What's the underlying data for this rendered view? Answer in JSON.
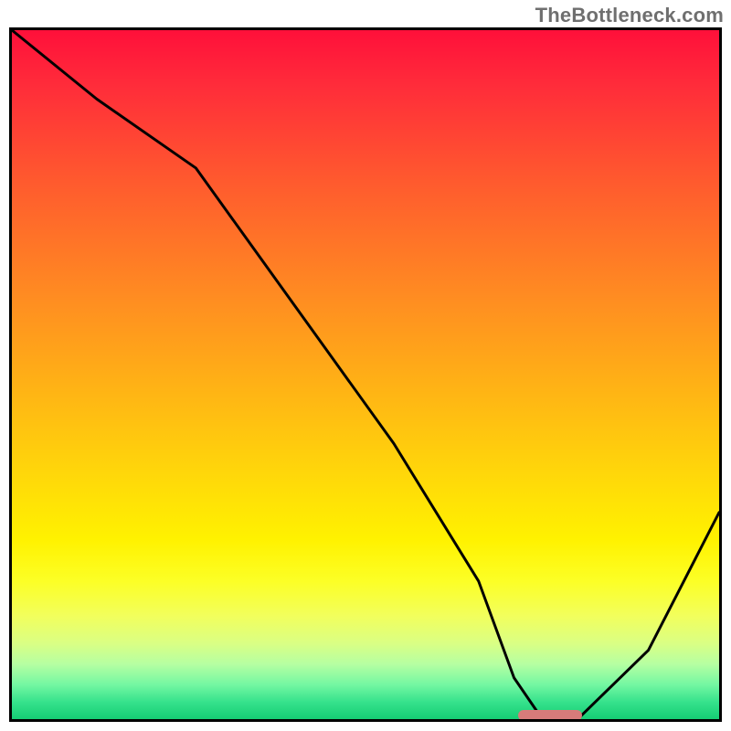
{
  "watermark": "TheBottleneck.com",
  "chart_data": {
    "type": "line",
    "title": "",
    "xlabel": "",
    "ylabel": "",
    "xlim": [
      0,
      100
    ],
    "ylim": [
      0,
      100
    ],
    "x": [
      0,
      12,
      26,
      40,
      54,
      66,
      71,
      75,
      80,
      90,
      100
    ],
    "y": [
      100,
      90,
      80,
      60,
      40,
      20,
      6,
      0,
      0,
      10,
      30
    ],
    "marker": {
      "x_start": 71,
      "x_end": 80,
      "y": 0,
      "color": "#d77b7a"
    },
    "background_gradient_stops": [
      {
        "pos": 0,
        "color": "#ff103a"
      },
      {
        "pos": 8,
        "color": "#ff2c3a"
      },
      {
        "pos": 22,
        "color": "#ff5a2e"
      },
      {
        "pos": 38,
        "color": "#ff8a22"
      },
      {
        "pos": 52,
        "color": "#ffb315"
      },
      {
        "pos": 64,
        "color": "#ffd60a"
      },
      {
        "pos": 74,
        "color": "#fff200"
      },
      {
        "pos": 80,
        "color": "#fcff26"
      },
      {
        "pos": 85,
        "color": "#f2ff5c"
      },
      {
        "pos": 89,
        "color": "#daff84"
      },
      {
        "pos": 92,
        "color": "#b6ffa2"
      },
      {
        "pos": 95,
        "color": "#74f7a2"
      },
      {
        "pos": 97.5,
        "color": "#36e28c"
      },
      {
        "pos": 100,
        "color": "#15cd74"
      }
    ]
  }
}
